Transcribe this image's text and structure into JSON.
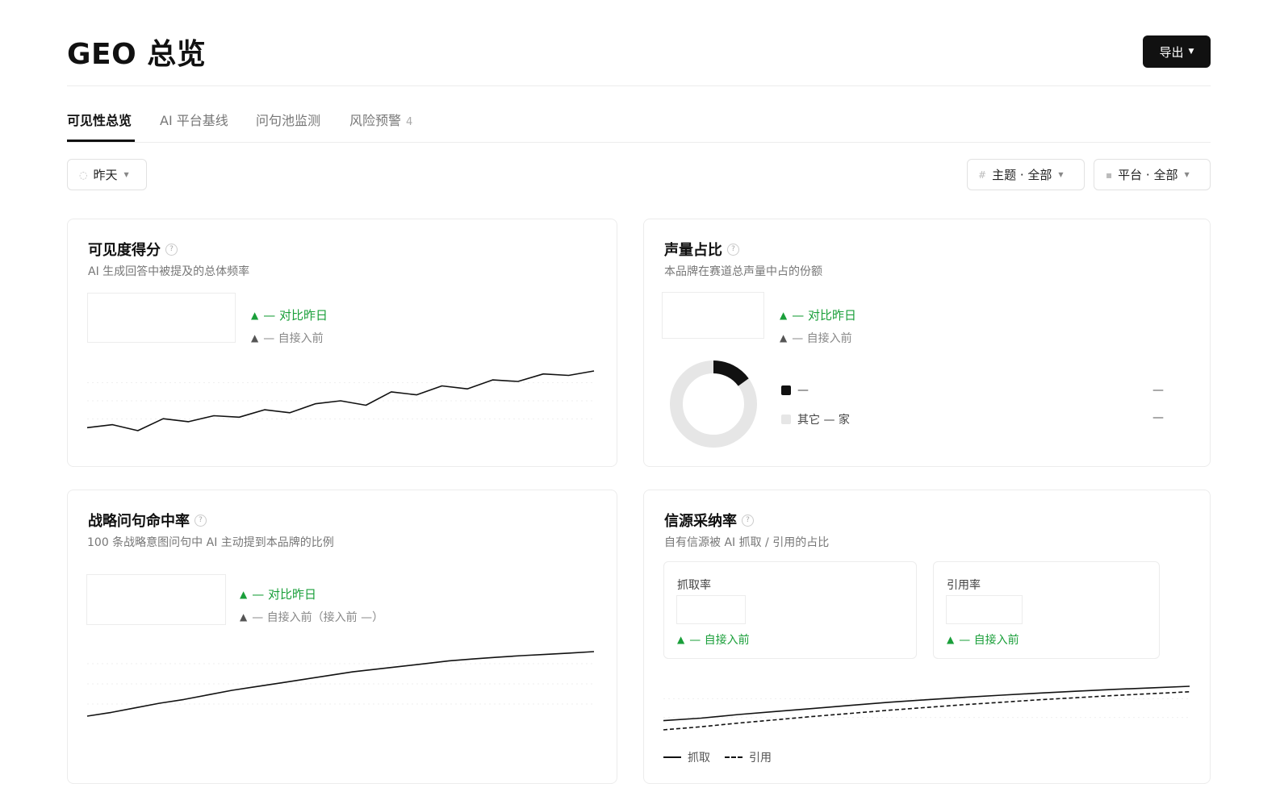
{
  "header": {
    "title": "GEO 总览",
    "export_label": "导出"
  },
  "tabs": [
    {
      "label": "可见性总览",
      "active": true
    },
    {
      "label": "AI 平台基线"
    },
    {
      "label": "问句池监测"
    },
    {
      "label": "风险预警",
      "count": "4"
    }
  ],
  "filters": {
    "date": "昨天",
    "topic": "主题 · 全部",
    "platform": "平台 · 全部"
  },
  "cards": {
    "visibility": {
      "title": "可见度得分",
      "subtitle": "AI 生成回答中被提及的总体频率",
      "delta_day": "— 对比昨日",
      "delta_base": "— 自接入前"
    },
    "voice": {
      "title": "声量占比",
      "subtitle": "本品牌在赛道总声量中占的份额",
      "delta_day": "— 对比昨日",
      "delta_base": "— 自接入前",
      "legend": [
        {
          "label": "—",
          "value": "—",
          "color": "#111111"
        },
        {
          "label": "其它 — 家",
          "value": "—",
          "color": "#e6e6e6"
        }
      ],
      "donut_share": 0.15
    },
    "strategic": {
      "title": "战略问句命中率",
      "subtitle": "100 条战略意图问句中 AI 主动提到本品牌的比例",
      "delta_day": "— 对比昨日",
      "delta_base": "— 自接入前（接入前 —）"
    },
    "source": {
      "title": "信源采纳率",
      "subtitle": "自有信源被 AI 抓取 / 引用的占比",
      "fetch": {
        "label": "抓取率",
        "delta": "— 自接入前"
      },
      "cite": {
        "label": "引用率",
        "delta": "— 自接入前"
      },
      "legend_fetch": "抓取",
      "legend_cite": "引用"
    }
  },
  "chart_data": [
    {
      "type": "line",
      "series": [
        {
          "values": [
            12,
            13,
            11,
            15,
            14,
            16,
            15.5,
            18,
            17,
            20,
            21,
            19.5,
            24,
            23,
            26,
            25,
            28,
            27.5,
            30,
            29.5,
            31
          ]
        }
      ]
    },
    {
      "type": "pie",
      "series": [
        {
          "values": [
            15,
            85
          ]
        }
      ]
    },
    {
      "type": "line",
      "series": [
        {
          "values": [
            10,
            12,
            14.5,
            17,
            19,
            21.5,
            24,
            26,
            28,
            30,
            32,
            34,
            35.5,
            37,
            38.5,
            40,
            41,
            42,
            42.8,
            43.5,
            44.2,
            45
          ]
        }
      ]
    },
    {
      "type": "line",
      "series": [
        {
          "values": [
            10,
            10.8,
            12,
            13,
            14,
            15,
            16,
            16.8,
            17.6,
            18.3,
            19,
            19.6,
            20.2,
            20.7,
            21.2
          ]
        },
        {
          "values": [
            7,
            8,
            9.2,
            10.3,
            11.4,
            12.4,
            13.4,
            14.3,
            15.2,
            16,
            16.8,
            17.5,
            18.2,
            18.8,
            19.4
          ]
        }
      ]
    }
  ]
}
